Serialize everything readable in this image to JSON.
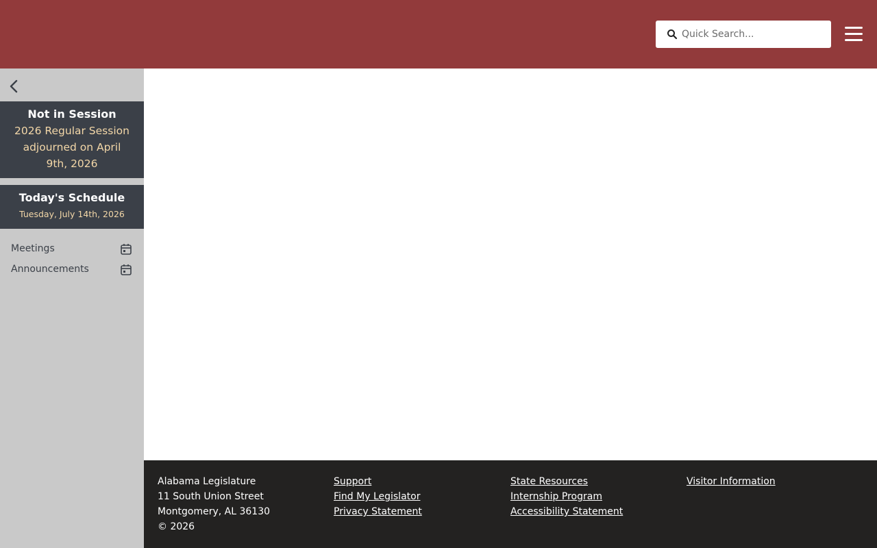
{
  "header": {
    "search_placeholder": "Quick Search...",
    "search_value": "",
    "icons": {
      "search": "magnifier-icon",
      "menu": "hamburger-icon"
    }
  },
  "sidebar": {
    "collapse_icon": "chevron-left-icon",
    "session": {
      "status": "Not in Session",
      "detail": "2026 Regular Session adjourned on April 9th, 2026"
    },
    "schedule": {
      "title": "Today's Schedule",
      "date": "Tuesday, July 14th, 2026"
    },
    "links": [
      {
        "label": "Meetings",
        "icon": "calendar-icon"
      },
      {
        "label": "Announcements",
        "icon": "calendar-icon"
      }
    ]
  },
  "footer": {
    "address": {
      "name": "Alabama Legislature",
      "street": "11 South Union Street",
      "city": "Montgomery, AL 36130",
      "copyright": "© 2026"
    },
    "links_col1": [
      "Support",
      "Find My Legislator",
      "Privacy Statement"
    ],
    "links_col2": [
      "State Resources",
      "Internship Program",
      "Accessibility Statement"
    ],
    "links_col3": [
      "Visitor Information"
    ]
  },
  "colors": {
    "header_bg": "#923a3b",
    "sidebar_bg": "#c9c9c9",
    "panel_bg": "#3b4048",
    "panel_accent_text": "#f3d7a8",
    "footer_bg": "#232221"
  }
}
